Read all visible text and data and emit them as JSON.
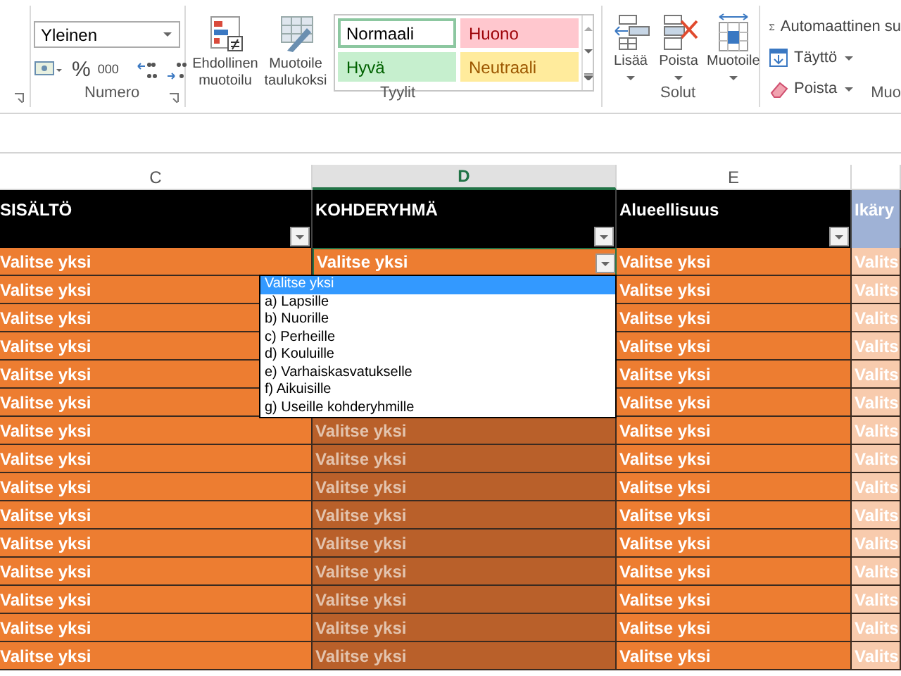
{
  "ribbon": {
    "number": {
      "label": "Numero",
      "format": "Yleinen",
      "percent": "%",
      "thousands": "000"
    },
    "styles": {
      "label": "Tyylit",
      "commands": [
        {
          "label": "Ehdollinen muotoilu",
          "kind": "conditional"
        },
        {
          "label": "Muotoile taulukoksi",
          "kind": "table"
        }
      ],
      "gallery": [
        {
          "text": "Normaali",
          "kind": "normal",
          "selected": true
        },
        {
          "text": "Huono",
          "kind": "bad",
          "selected": false
        },
        {
          "text": "Hyvä",
          "kind": "good",
          "selected": false
        },
        {
          "text": "Neutraali",
          "kind": "neutral",
          "selected": false
        }
      ]
    },
    "cells": {
      "label": "Solut",
      "commands": [
        {
          "label": "Lisää",
          "kind": "insert"
        },
        {
          "label": "Poista",
          "kind": "delete"
        },
        {
          "label": "Muotoile",
          "kind": "format"
        }
      ]
    },
    "editing": {
      "label": "Muo",
      "commands": [
        {
          "label": "Automaattinen su",
          "kind": "sum"
        },
        {
          "label": "Täyttö",
          "kind": "fill"
        },
        {
          "label": "Poista",
          "kind": "clear"
        }
      ]
    }
  },
  "sheet": {
    "columns": [
      {
        "letter": "C",
        "selected": false,
        "kind": "orange"
      },
      {
        "letter": "D",
        "selected": true,
        "kind": "orange"
      },
      {
        "letter": "E",
        "selected": false,
        "kind": "orange"
      },
      {
        "selected": false,
        "kind": "peach"
      }
    ],
    "headers": [
      {
        "text": "SISÄLTÖ",
        "filter": true
      },
      {
        "text": "KOHDERYHMÄ",
        "filter": true
      },
      {
        "text": "Alueellisuus",
        "filter": true
      },
      {
        "text": "Ikäry",
        "filter": false
      }
    ],
    "rows": [
      {
        "cells": [
          {
            "text": "Valitse yksi",
            "selected": false,
            "active": false
          },
          {
            "text": "Valitse yksi",
            "active": true
          },
          {
            "text": "Valitse yksi",
            "selected": false,
            "active": false
          },
          {
            "text": "Valits",
            "selected": false,
            "active": false
          }
        ]
      },
      {
        "cells": [
          {
            "text": "Valitse yksi",
            "selected": false,
            "active": false
          },
          {},
          {
            "text": "Valitse yksi",
            "selected": false,
            "active": false
          },
          {
            "text": "Valits",
            "selected": false,
            "active": false
          }
        ]
      },
      {
        "cells": [
          {
            "text": "Valitse yksi",
            "selected": false,
            "active": false
          },
          {},
          {
            "text": "Valitse yksi",
            "selected": false,
            "active": false
          },
          {
            "text": "Valits",
            "selected": false,
            "active": false
          }
        ]
      },
      {
        "cells": [
          {
            "text": "Valitse yksi",
            "selected": false,
            "active": false
          },
          {},
          {
            "text": "Valitse yksi",
            "selected": false,
            "active": false
          },
          {
            "text": "Valits",
            "selected": false,
            "active": false
          }
        ]
      },
      {
        "cells": [
          {
            "text": "Valitse yksi",
            "selected": false,
            "active": false
          },
          {},
          {
            "text": "Valitse yksi",
            "selected": false,
            "active": false
          },
          {
            "text": "Valits",
            "selected": false,
            "active": false
          }
        ]
      },
      {
        "cells": [
          {
            "text": "Valitse yksi",
            "selected": false,
            "active": false
          },
          {},
          {
            "text": "Valitse yksi",
            "selected": false,
            "active": false
          },
          {
            "text": "Valits",
            "selected": false,
            "active": false
          }
        ]
      },
      {
        "cells": [
          {
            "text": "Valitse yksi",
            "selected": false,
            "active": false
          },
          {
            "text": "Valitse yksi",
            "selected": true,
            "active": false
          },
          {
            "text": "Valitse yksi",
            "selected": false,
            "active": false
          },
          {
            "text": "Valits",
            "selected": false,
            "active": false
          }
        ]
      },
      {
        "cells": [
          {
            "text": "Valitse yksi",
            "selected": false,
            "active": false
          },
          {
            "text": "Valitse yksi",
            "selected": true,
            "active": false
          },
          {
            "text": "Valitse yksi",
            "selected": false,
            "active": false
          },
          {
            "text": "Valits",
            "selected": false,
            "active": false
          }
        ]
      },
      {
        "cells": [
          {
            "text": "Valitse yksi",
            "selected": false,
            "active": false
          },
          {
            "text": "Valitse yksi",
            "selected": true,
            "active": false
          },
          {
            "text": "Valitse yksi",
            "selected": false,
            "active": false
          },
          {
            "text": "Valits",
            "selected": false,
            "active": false
          }
        ]
      },
      {
        "cells": [
          {
            "text": "Valitse yksi",
            "selected": false,
            "active": false
          },
          {
            "text": "Valitse yksi",
            "selected": true,
            "active": false
          },
          {
            "text": "Valitse yksi",
            "selected": false,
            "active": false
          },
          {
            "text": "Valits",
            "selected": false,
            "active": false
          }
        ]
      },
      {
        "cells": [
          {
            "text": "Valitse yksi",
            "selected": false,
            "active": false
          },
          {
            "text": "Valitse yksi",
            "selected": true,
            "active": false
          },
          {
            "text": "Valitse yksi",
            "selected": false,
            "active": false
          },
          {
            "text": "Valits",
            "selected": false,
            "active": false
          }
        ]
      },
      {
        "cells": [
          {
            "text": "Valitse yksi",
            "selected": false,
            "active": false
          },
          {
            "text": "Valitse yksi",
            "selected": true,
            "active": false
          },
          {
            "text": "Valitse yksi",
            "selected": false,
            "active": false
          },
          {
            "text": "Valits",
            "selected": false,
            "active": false
          }
        ]
      },
      {
        "cells": [
          {
            "text": "Valitse yksi",
            "selected": false,
            "active": false
          },
          {
            "text": "Valitse yksi",
            "selected": true,
            "active": false
          },
          {
            "text": "Valitse yksi",
            "selected": false,
            "active": false
          },
          {
            "text": "Valits",
            "selected": false,
            "active": false
          }
        ]
      },
      {
        "cells": [
          {
            "text": "Valitse yksi",
            "selected": false,
            "active": false
          },
          {
            "text": "Valitse yksi",
            "selected": true,
            "active": false
          },
          {
            "text": "Valitse yksi",
            "selected": false,
            "active": false
          },
          {
            "text": "Valits",
            "selected": false,
            "active": false
          }
        ]
      },
      {
        "cells": [
          {
            "text": "Valitse yksi",
            "selected": false,
            "active": false
          },
          {
            "text": "Valitse yksi",
            "selected": true,
            "active": false
          },
          {
            "text": "Valitse yksi",
            "selected": false,
            "active": false
          },
          {
            "text": "Valits",
            "selected": false,
            "active": false
          }
        ]
      }
    ]
  },
  "dropdown": {
    "items": [
      {
        "text": "Valitse yksi",
        "selected": true
      },
      {
        "text": "a) Lapsille",
        "selected": false
      },
      {
        "text": "b) Nuorille",
        "selected": false
      },
      {
        "text": "c) Perheille",
        "selected": false
      },
      {
        "text": "d) Kouluille",
        "selected": false
      },
      {
        "text": "e) Varhaiskasvatukselle",
        "selected": false
      },
      {
        "text": "f) Aikuisille",
        "selected": false
      },
      {
        "text": "g) Useille kohderyhmille",
        "selected": false
      }
    ]
  }
}
